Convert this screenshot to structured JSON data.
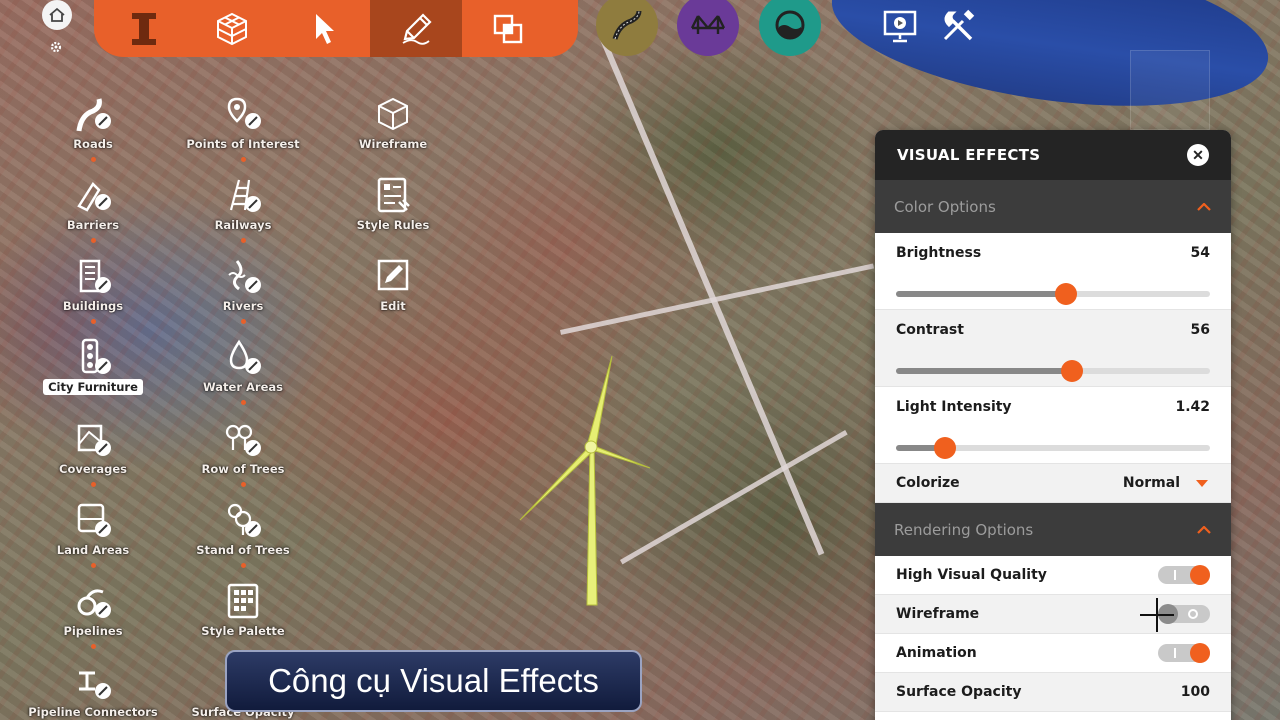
{
  "toolbar": {
    "main_tools": [
      "layers-icon",
      "3d-object-icon",
      "select-pointer-icon",
      "draw-pencil-icon",
      "copy-overlap-icon"
    ],
    "round_tools": [
      {
        "icon": "road-tool-icon",
        "color": "#8f7c3e"
      },
      {
        "icon": "bridge-tool-icon",
        "color": "#6a3a98"
      },
      {
        "icon": "water-tool-icon",
        "color": "#1f9a8a"
      }
    ],
    "right_tools": [
      "presentation-icon",
      "tools-settings-icon"
    ],
    "accent_color": "#e8602a",
    "active_color": "#a8461d"
  },
  "palette": {
    "col1": [
      {
        "label": "Roads",
        "icon": "roads-icon"
      },
      {
        "label": "Barriers",
        "icon": "barriers-icon"
      },
      {
        "label": "Buildings",
        "icon": "buildings-icon"
      },
      {
        "label": "City Furniture",
        "icon": "city-furniture-icon",
        "selected": true
      },
      {
        "label": "Coverages",
        "icon": "coverages-icon"
      },
      {
        "label": "Land Areas",
        "icon": "land-areas-icon"
      },
      {
        "label": "Pipelines",
        "icon": "pipelines-icon"
      },
      {
        "label": "Pipeline Connectors",
        "icon": "pipeline-connectors-icon"
      }
    ],
    "col2": [
      {
        "label": "Points of Interest",
        "icon": "points-of-interest-icon"
      },
      {
        "label": "Railways",
        "icon": "railways-icon"
      },
      {
        "label": "Rivers",
        "icon": "rivers-icon"
      },
      {
        "label": "Water Areas",
        "icon": "water-areas-icon"
      },
      {
        "label": "Row of Trees",
        "icon": "row-of-trees-icon"
      },
      {
        "label": "Stand of Trees",
        "icon": "stand-of-trees-icon"
      },
      {
        "label": "Style Palette",
        "icon": "style-palette-icon"
      },
      {
        "label": "Surface Opacity",
        "icon": "surface-opacity-icon"
      }
    ],
    "col3": [
      {
        "label": "Wireframe",
        "icon": "wireframe-icon"
      },
      {
        "label": "Style Rules",
        "icon": "style-rules-icon"
      },
      {
        "label": "Edit",
        "icon": "edit-icon"
      }
    ]
  },
  "panel": {
    "title": "VISUAL EFFECTS",
    "color_options": {
      "label": "Color Options",
      "brightness": {
        "label": "Brightness",
        "value": "54",
        "fraction": 0.54
      },
      "contrast": {
        "label": "Contrast",
        "value": "56",
        "fraction": 0.56
      },
      "light_intensity": {
        "label": "Light Intensity",
        "value": "1.42",
        "fraction": 0.155
      },
      "colorize": {
        "label": "Colorize",
        "value": "Normal"
      }
    },
    "rendering_options": {
      "label": "Rendering Options",
      "high_visual_quality": {
        "label": "High Visual Quality",
        "on": true
      },
      "wireframe": {
        "label": "Wireframe",
        "on": false
      },
      "animation": {
        "label": "Animation",
        "on": true
      },
      "surface_opacity": {
        "label": "Surface Opacity",
        "value": "100"
      }
    }
  },
  "caption": "Công cụ Visual Effects"
}
